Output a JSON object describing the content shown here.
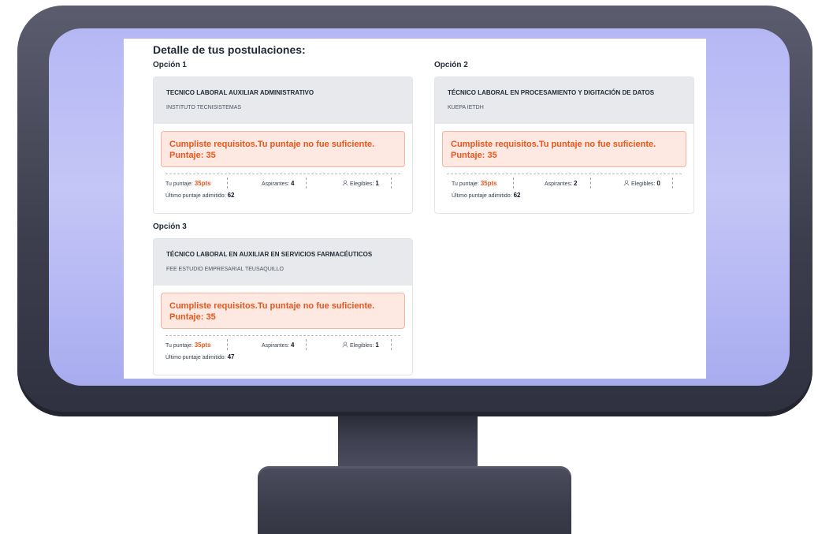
{
  "page": {
    "title": "Detalle de tus postulaciones:"
  },
  "options": [
    {
      "label": "Opción 1",
      "program": "TECNICO LABORAL AUXILIAR ADMINISTRATIVO",
      "institution": "INSTITUTO TECNISISTEMAS",
      "alert_line1": "Cumpliste requisitos.Tu puntaje no fue suficiente.",
      "alert_line2": "Puntaje: 35",
      "score_label": "Tu puntaje:",
      "score_value": "35pts",
      "applicants_label": "Aspirantes:",
      "applicants_value": "4",
      "eligible_label": "Elegibles:",
      "eligible_value": "1",
      "last_label": "Último puntaje adimitido:",
      "last_value": "62"
    },
    {
      "label": "Opción 2",
      "program": "TÉCNICO LABORAL EN PROCESAMIENTO Y DIGITACIÓN DE DATOS",
      "institution": "KUEPA IETDH",
      "alert_line1": "Cumpliste requisitos.Tu puntaje no fue suficiente.",
      "alert_line2": "Puntaje: 35",
      "score_label": "Tu puntaje:",
      "score_value": "35pts",
      "applicants_label": "Aspirantes:",
      "applicants_value": "2",
      "eligible_label": "Elegibles:",
      "eligible_value": "0",
      "last_label": "Último puntaje adimitido:",
      "last_value": "62"
    },
    {
      "label": "Opción 3",
      "program": "TÉCNICO LABORAL EN AUXILIAR EN SERVICIOS FARMACÉUTICOS",
      "institution": "FEE ESTUDIO EMPRESARIAL TEUSAQUILLO",
      "alert_line1": "Cumpliste requisitos.Tu puntaje no fue suficiente.",
      "alert_line2": "Puntaje: 35",
      "score_label": "Tu puntaje:",
      "score_value": "35pts",
      "applicants_label": "Aspirantes:",
      "applicants_value": "4",
      "eligible_label": "Elegibles:",
      "eligible_value": "1",
      "last_label": "Último puntaje adimitido:",
      "last_value": "47"
    }
  ],
  "colors": {
    "accent": "#e8561c",
    "alert_bg": "#fde8e2",
    "card_head_bg": "#e8e9ec",
    "monitor_glow": "#b5b8f4"
  },
  "icons": {
    "eligible": "person-icon"
  }
}
